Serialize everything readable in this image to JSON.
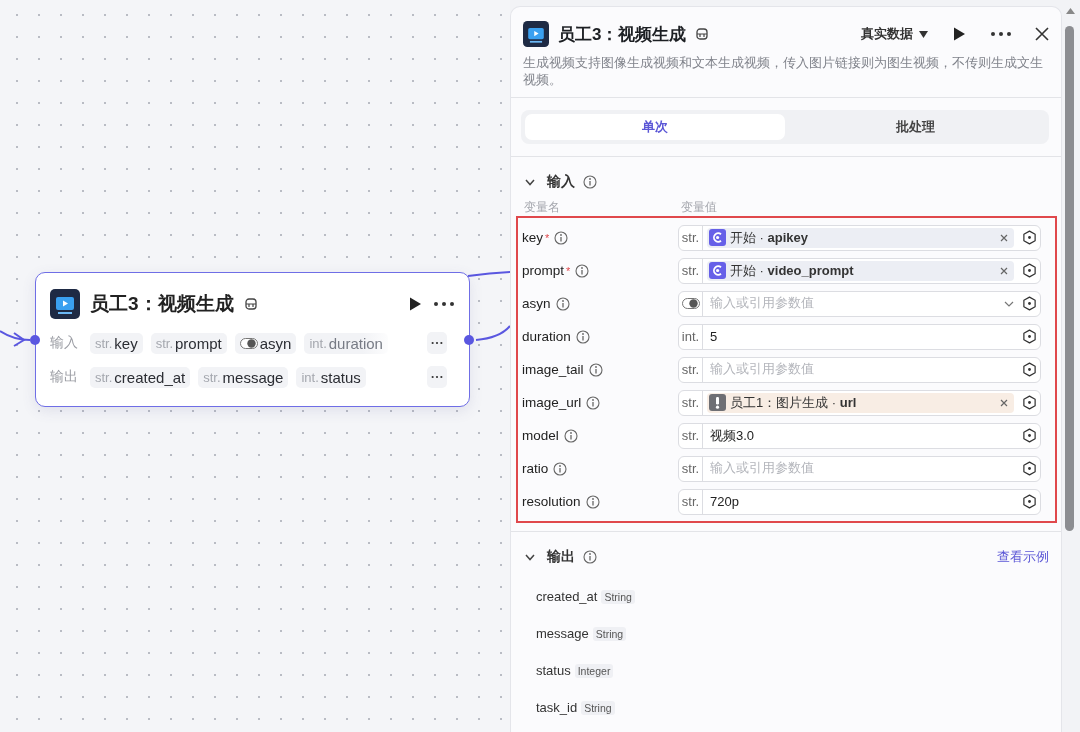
{
  "canvas": {
    "node": {
      "title": "员工3：视频生成",
      "input_label": "输入",
      "inputs": [
        {
          "kind": "typed",
          "type": "str.",
          "name": "key"
        },
        {
          "kind": "typed",
          "type": "str.",
          "name": "prompt"
        },
        {
          "kind": "toggle",
          "name": "asyn"
        },
        {
          "kind": "typed",
          "type": "int.",
          "name": "duration",
          "faded": true
        }
      ],
      "output_label": "输出",
      "outputs": [
        {
          "kind": "typed",
          "type": "str.",
          "name": "created_at"
        },
        {
          "kind": "typed",
          "type": "str.",
          "name": "message"
        },
        {
          "kind": "typed",
          "type": "int.",
          "name": "status"
        }
      ]
    }
  },
  "panel": {
    "title": "员工3：视频生成",
    "data_source": "真实数据",
    "description": "生成视频支持图像生成视频和文本生成视频，传入图片链接则为图生视频，不传则生成文生视频。",
    "tabs": [
      {
        "label": "单次",
        "selected": true
      },
      {
        "label": "批处理",
        "selected": false
      }
    ],
    "input_section": {
      "title": "输入",
      "expanded": true,
      "columns": [
        "变量名",
        "变量值"
      ],
      "required_mark": "*",
      "params": [
        {
          "name": "key",
          "required": true,
          "kind": "ref",
          "type": "str.",
          "reference": "开始 · **apikey**",
          "warning": false
        },
        {
          "name": "prompt",
          "required": true,
          "kind": "ref",
          "type": "str.",
          "reference": "开始 · **video_prompt**",
          "warning": false
        },
        {
          "name": "asyn",
          "required": false,
          "kind": "toggle",
          "placeholder": "输入或引用参数值"
        },
        {
          "name": "duration",
          "required": false,
          "kind": "text",
          "type": "int.",
          "value": "5"
        },
        {
          "name": "image_tail",
          "required": false,
          "kind": "text",
          "type": "str.",
          "placeholder": "输入或引用参数值"
        },
        {
          "name": "image_url",
          "required": false,
          "kind": "ref",
          "type": "str.",
          "reference": "员工1：图片生成 · **url**",
          "warning": true
        },
        {
          "name": "model",
          "required": false,
          "kind": "text",
          "type": "str.",
          "value": "视频3.0"
        },
        {
          "name": "ratio",
          "required": false,
          "kind": "text",
          "type": "str.",
          "placeholder": "输入或引用参数值"
        },
        {
          "name": "resolution",
          "required": false,
          "kind": "text",
          "type": "str.",
          "value": "720p"
        }
      ]
    },
    "output_section": {
      "title": "输出",
      "expanded": true,
      "link": "查看示例",
      "outputs": [
        {
          "name": "created_at",
          "type": "String"
        },
        {
          "name": "message",
          "type": "String"
        },
        {
          "name": "status",
          "type": "Integer"
        },
        {
          "name": "task_id",
          "type": "String"
        }
      ]
    }
  }
}
